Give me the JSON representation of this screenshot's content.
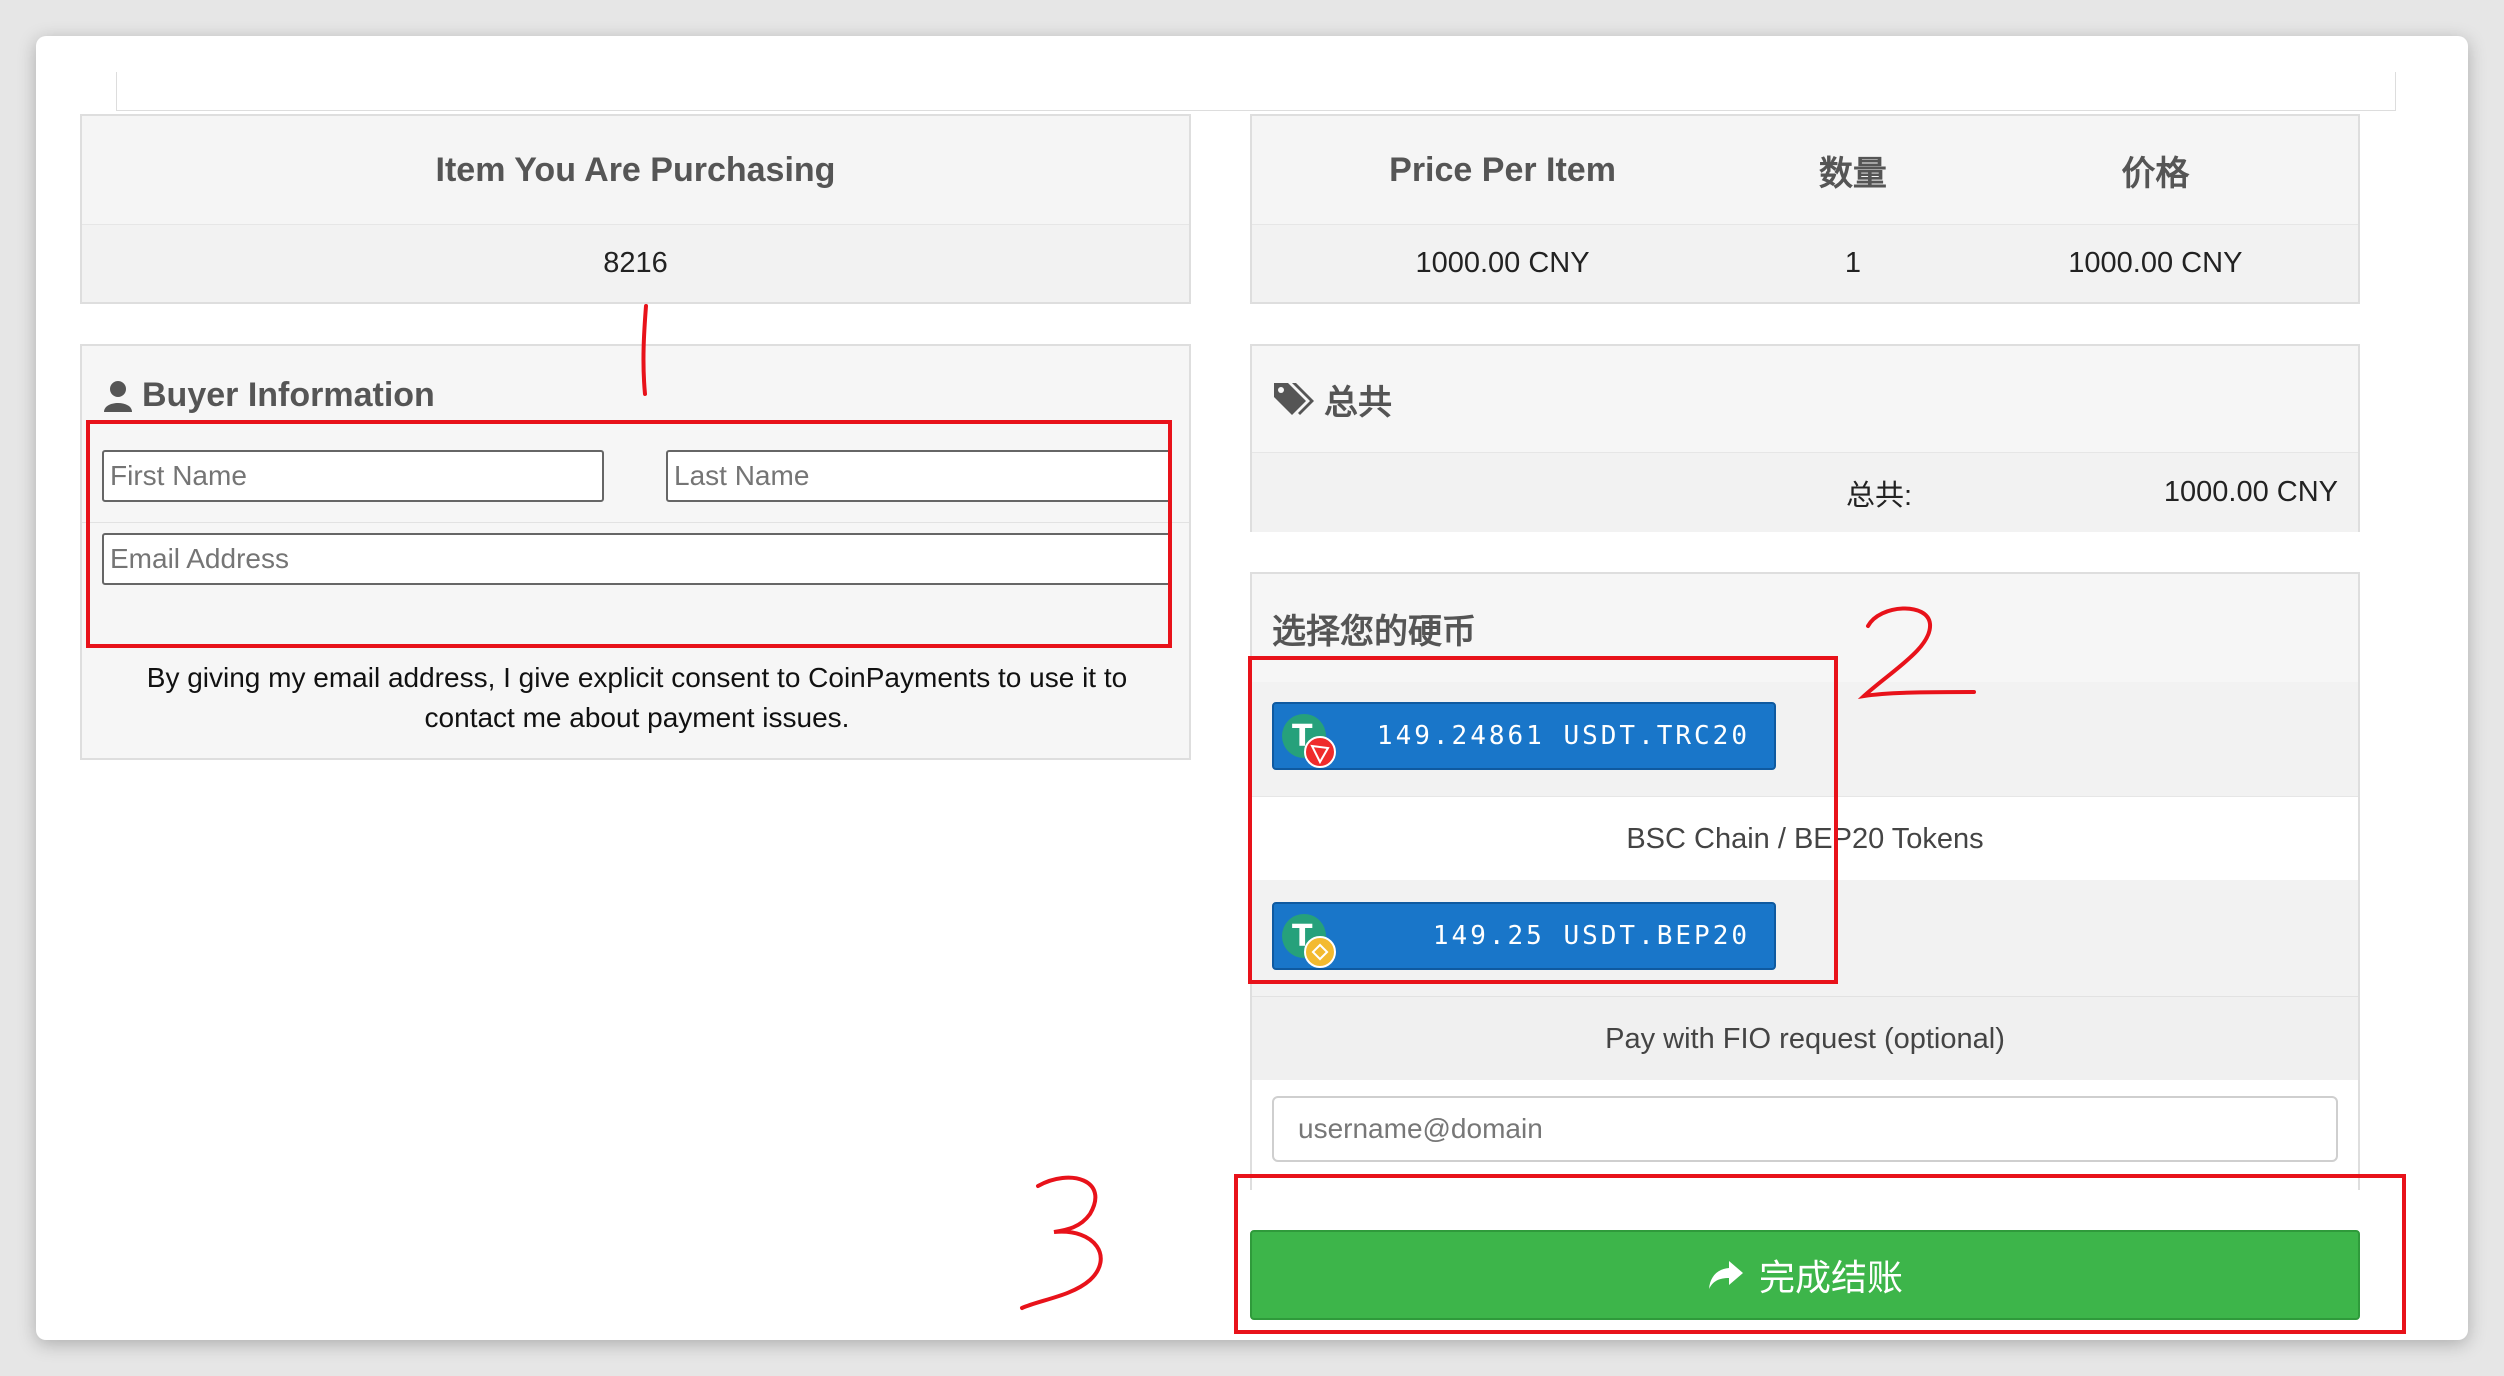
{
  "item_panel": {
    "header": "Item You Are Purchasing",
    "value": "8216"
  },
  "price_panel": {
    "headers": [
      "Price Per Item",
      "数量",
      "价格"
    ],
    "row": [
      "1000.00 CNY",
      "1",
      "1000.00 CNY"
    ]
  },
  "buyer": {
    "title": "Buyer Information",
    "first_name_placeholder": "First Name",
    "last_name_placeholder": "Last Name",
    "email_placeholder": "Email Address",
    "consent": "By giving my email address, I give explicit consent to CoinPayments to use it to contact me about payment issues."
  },
  "total": {
    "title": "总共",
    "label": "总共:",
    "value": "1000.00 CNY"
  },
  "coins": {
    "title": "选择您的硬币",
    "trc20_button": "149.24861 USDT.TRC20",
    "chain_label": "BSC Chain / BEP20 Tokens",
    "bep20_button": "149.25 USDT.BEP20",
    "fio_label": "Pay with FIO request (optional)",
    "fio_placeholder": "username@domain"
  },
  "checkout": {
    "label": "完成结账"
  },
  "annotations": {
    "color": "#e8121a",
    "marks": [
      "1",
      "2",
      "3"
    ]
  }
}
